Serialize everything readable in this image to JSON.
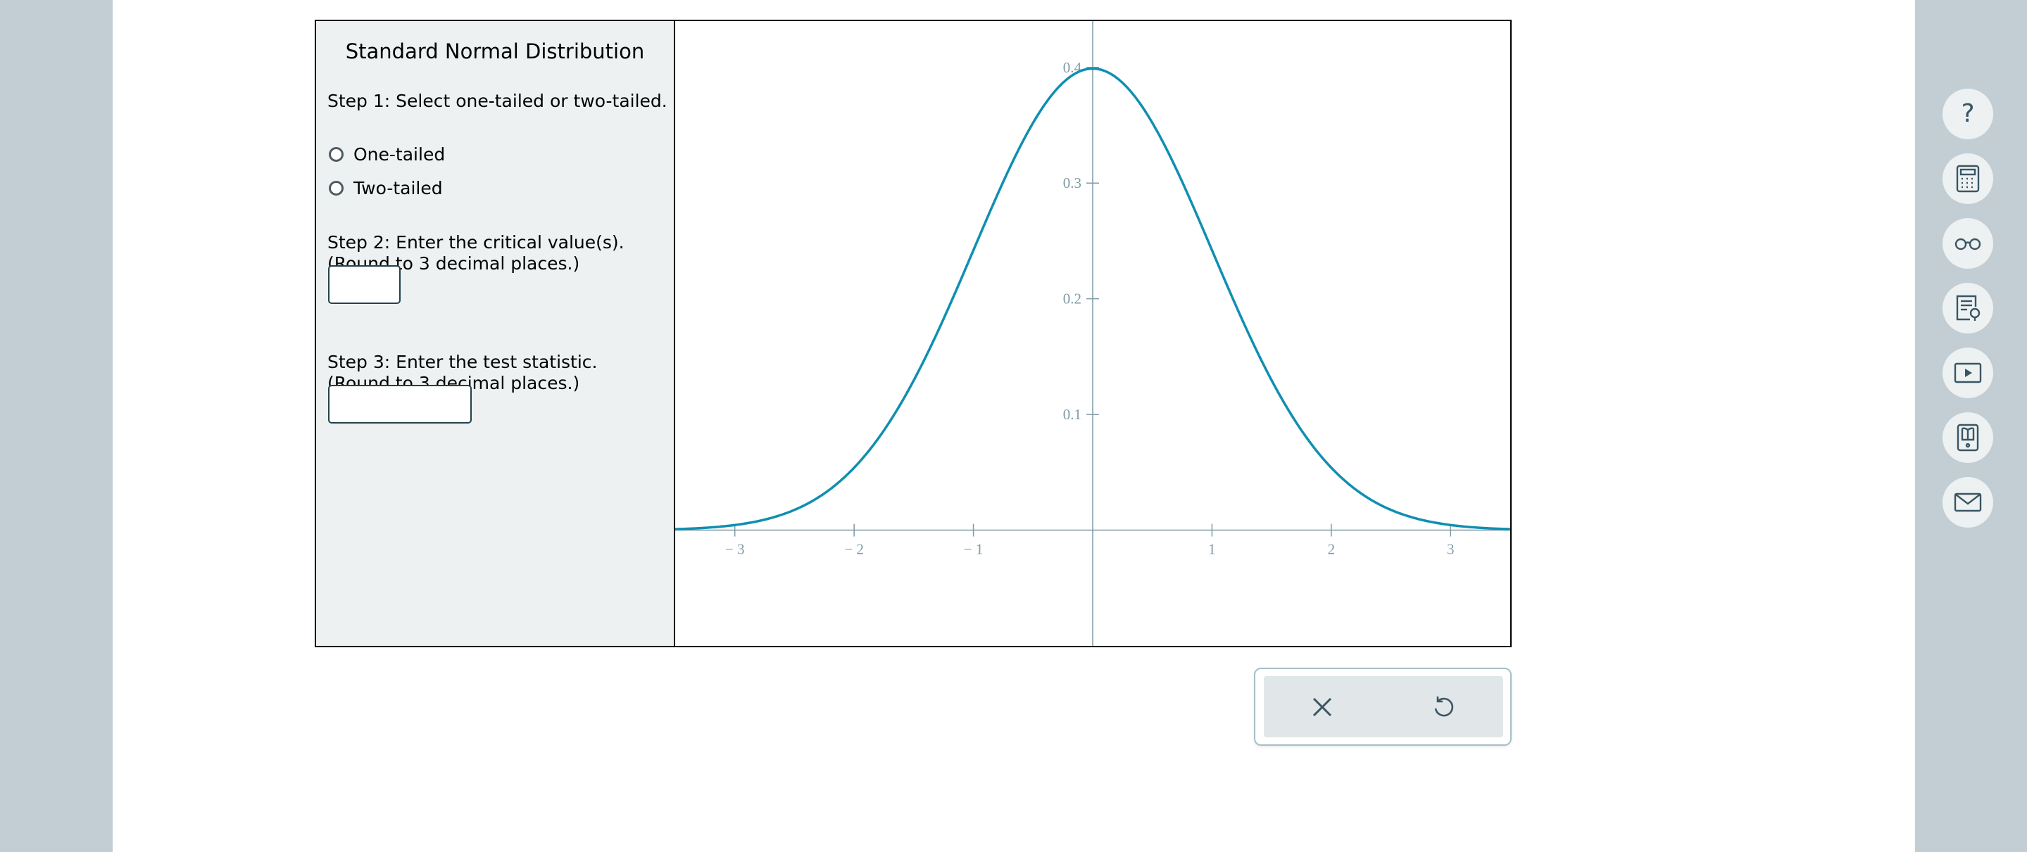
{
  "panel": {
    "title": "Standard Normal Distribution",
    "step1": "Step 1: Select one-tailed or two-tailed.",
    "options": [
      {
        "label": "One-tailed",
        "selected": false
      },
      {
        "label": "Two-tailed",
        "selected": false
      }
    ],
    "step2_line1": "Step 2: Enter the critical value(s).",
    "step2_line2": "(Round to 3 decimal places.)",
    "critical_value": "",
    "step3_line1": "Step 3: Enter the test statistic.",
    "step3_line2": "(Round to 3 decimal places.)",
    "test_statistic": ""
  },
  "chart_data": {
    "type": "line",
    "series": [
      {
        "function": "standard normal pdf",
        "mean": 0,
        "sd": 1
      }
    ],
    "xlim": [
      -3.5,
      3.5
    ],
    "ylim": [
      -0.1,
      0.44
    ],
    "x_ticks": [
      -3,
      -2,
      -1,
      1,
      2,
      3
    ],
    "x_tick_labels": [
      "− 3",
      "− 2",
      "− 1",
      "1",
      "2",
      "3"
    ],
    "y_ticks": [
      0.1,
      0.2,
      0.3,
      0.4
    ],
    "y_tick_labels": [
      "0.1",
      "0.2",
      "0.3",
      "0.4"
    ],
    "curve_color": "#0f8fb0",
    "axis_color": "#7f9aa6"
  },
  "actions": {
    "clear_icon": "close-icon",
    "reset_icon": "undo-icon"
  },
  "side_toolbar": [
    "help-icon",
    "calculator-icon",
    "glasses-icon",
    "hint-icon",
    "video-icon",
    "ebook-icon",
    "mail-icon"
  ]
}
